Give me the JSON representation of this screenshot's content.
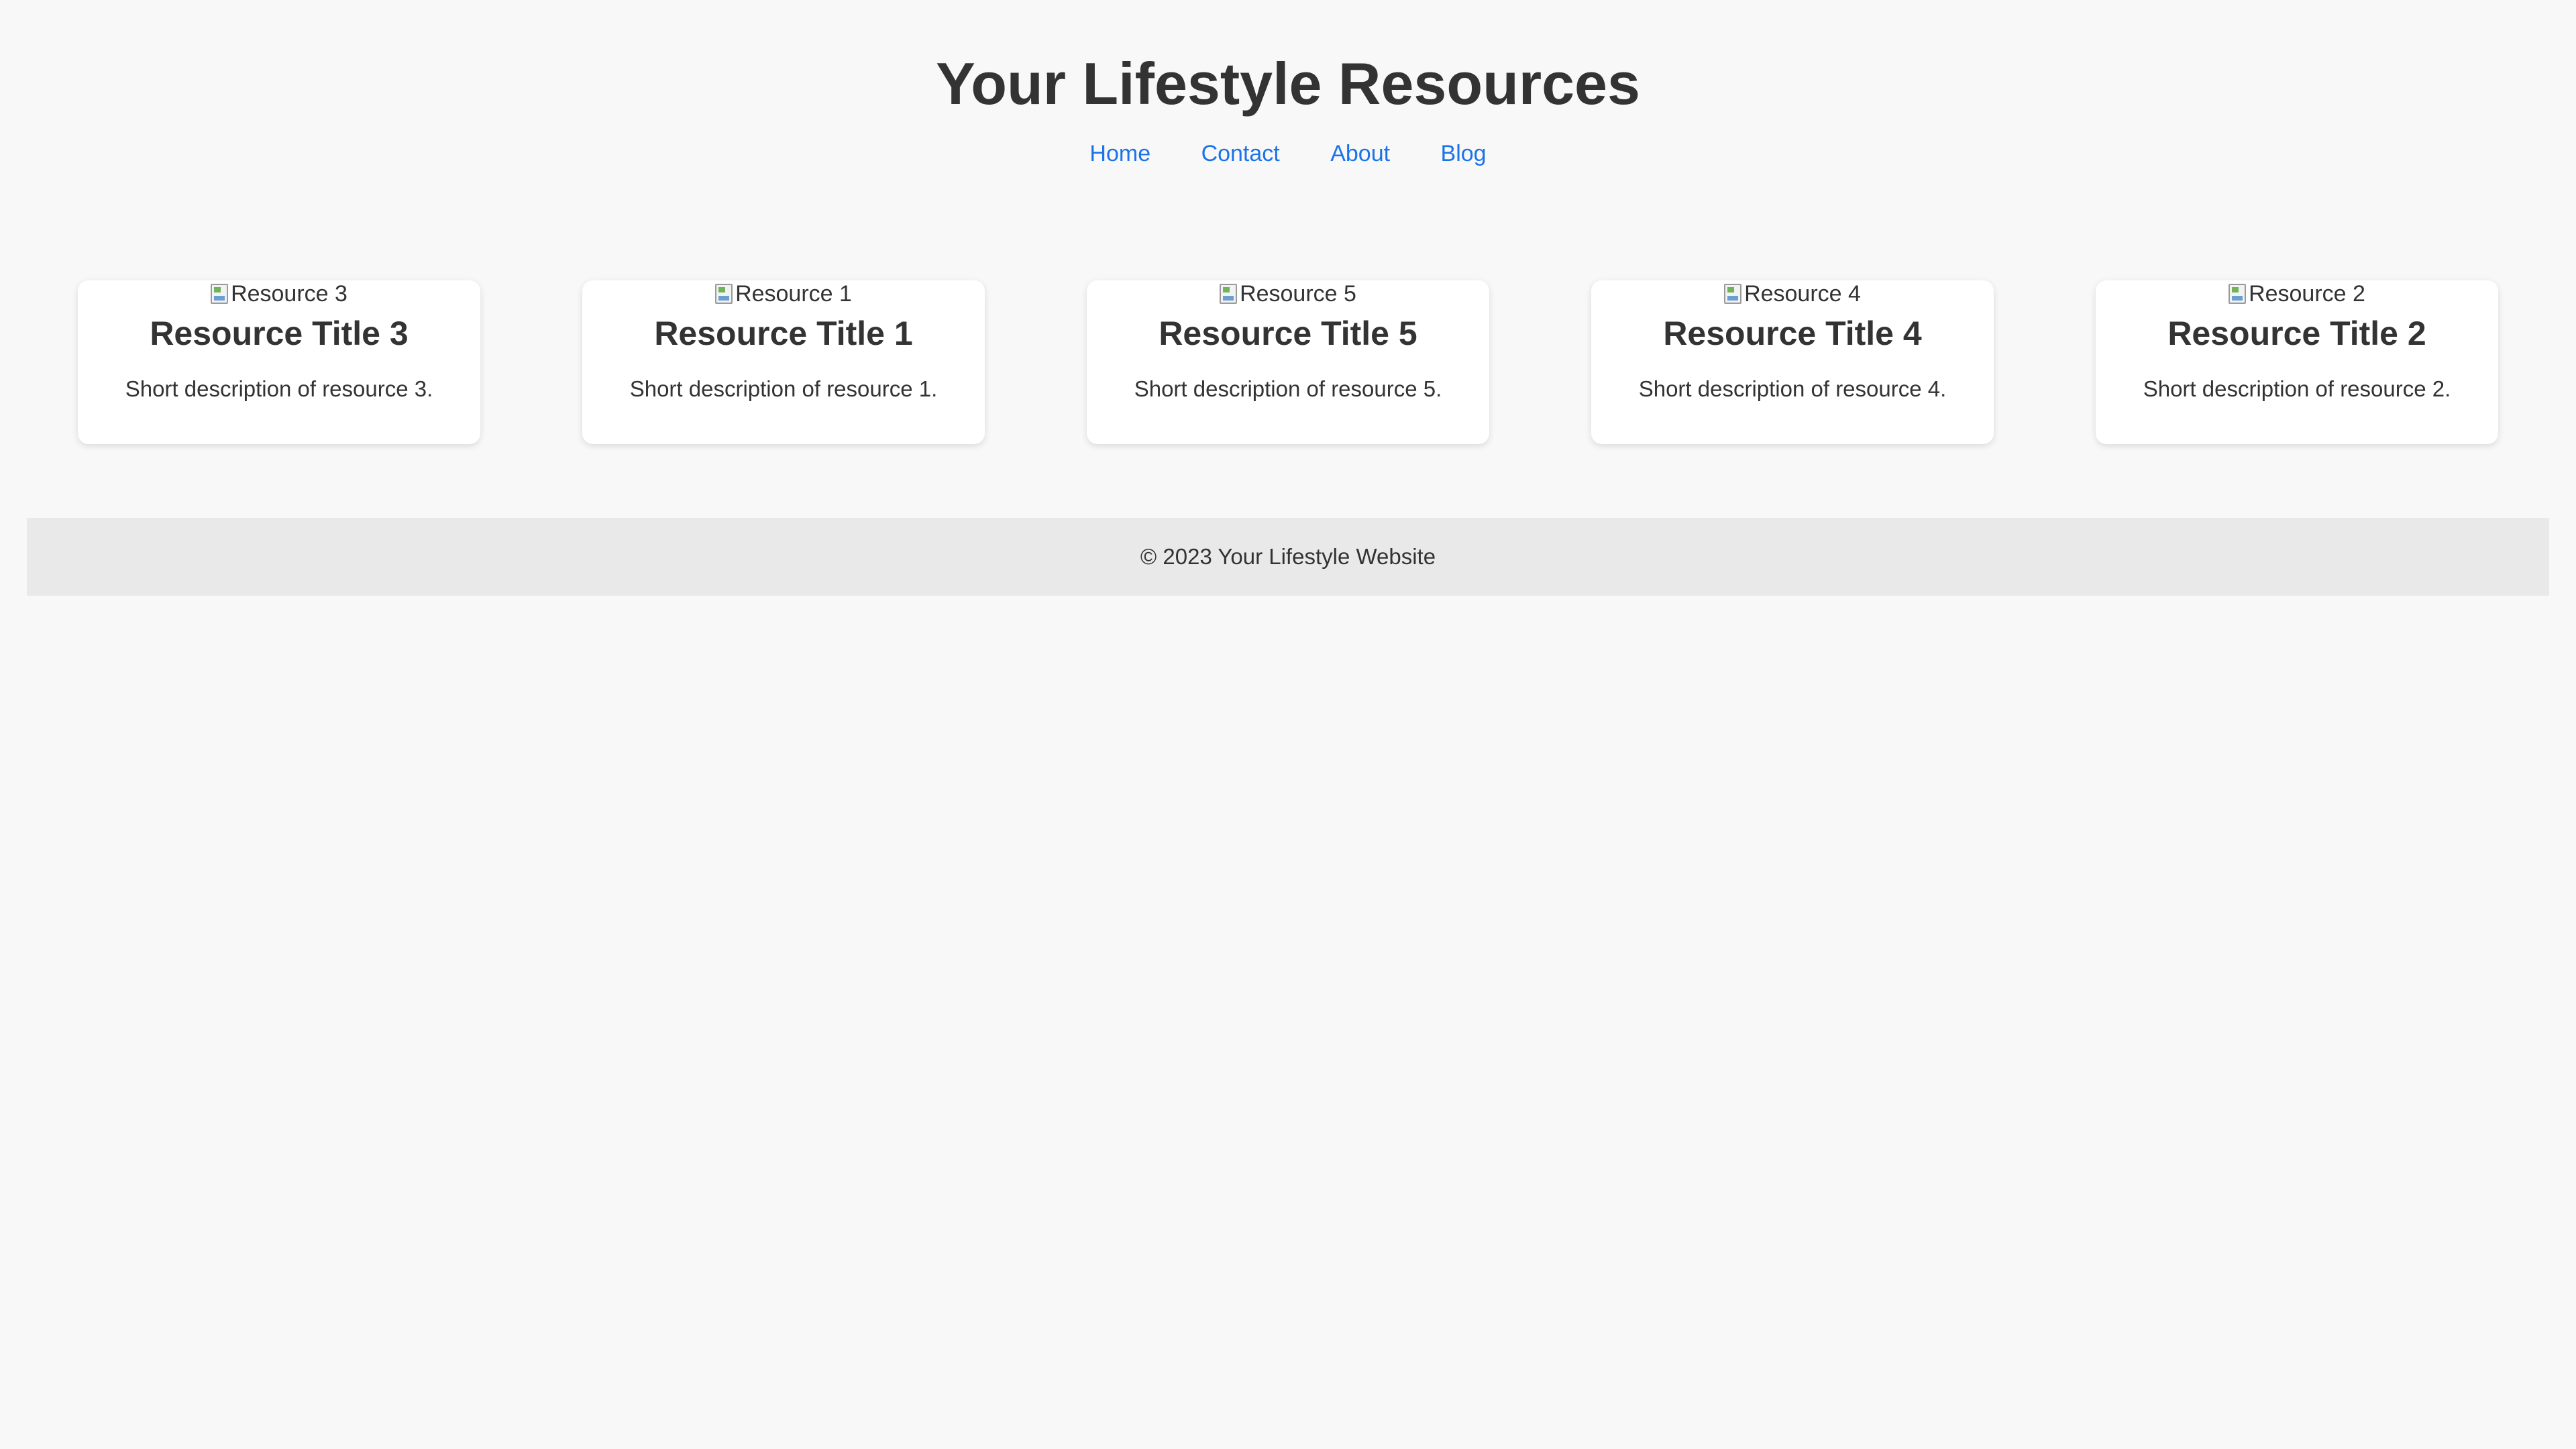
{
  "header": {
    "title": "Your Lifestyle Resources"
  },
  "nav": {
    "items": [
      {
        "label": "Home"
      },
      {
        "label": "Contact"
      },
      {
        "label": "About"
      },
      {
        "label": "Blog"
      }
    ]
  },
  "resources": {
    "cards": [
      {
        "image_alt": "Resource 3",
        "title": "Resource Title 3",
        "description": "Short description of resource 3."
      },
      {
        "image_alt": "Resource 1",
        "title": "Resource Title 1",
        "description": "Short description of resource 1."
      },
      {
        "image_alt": "Resource 5",
        "title": "Resource Title 5",
        "description": "Short description of resource 5."
      },
      {
        "image_alt": "Resource 4",
        "title": "Resource Title 4",
        "description": "Short description of resource 4."
      },
      {
        "image_alt": "Resource 2",
        "title": "Resource Title 2",
        "description": "Short description of resource 2."
      }
    ]
  },
  "footer": {
    "text": "© 2023 Your Lifestyle Website"
  },
  "colors": {
    "background": "#f8f8f8",
    "text": "#333333",
    "link": "#1a73e8",
    "card": "#ffffff",
    "footer": "#e9e9e9"
  },
  "icons": {
    "image_placeholder": "broken-image-icon"
  }
}
